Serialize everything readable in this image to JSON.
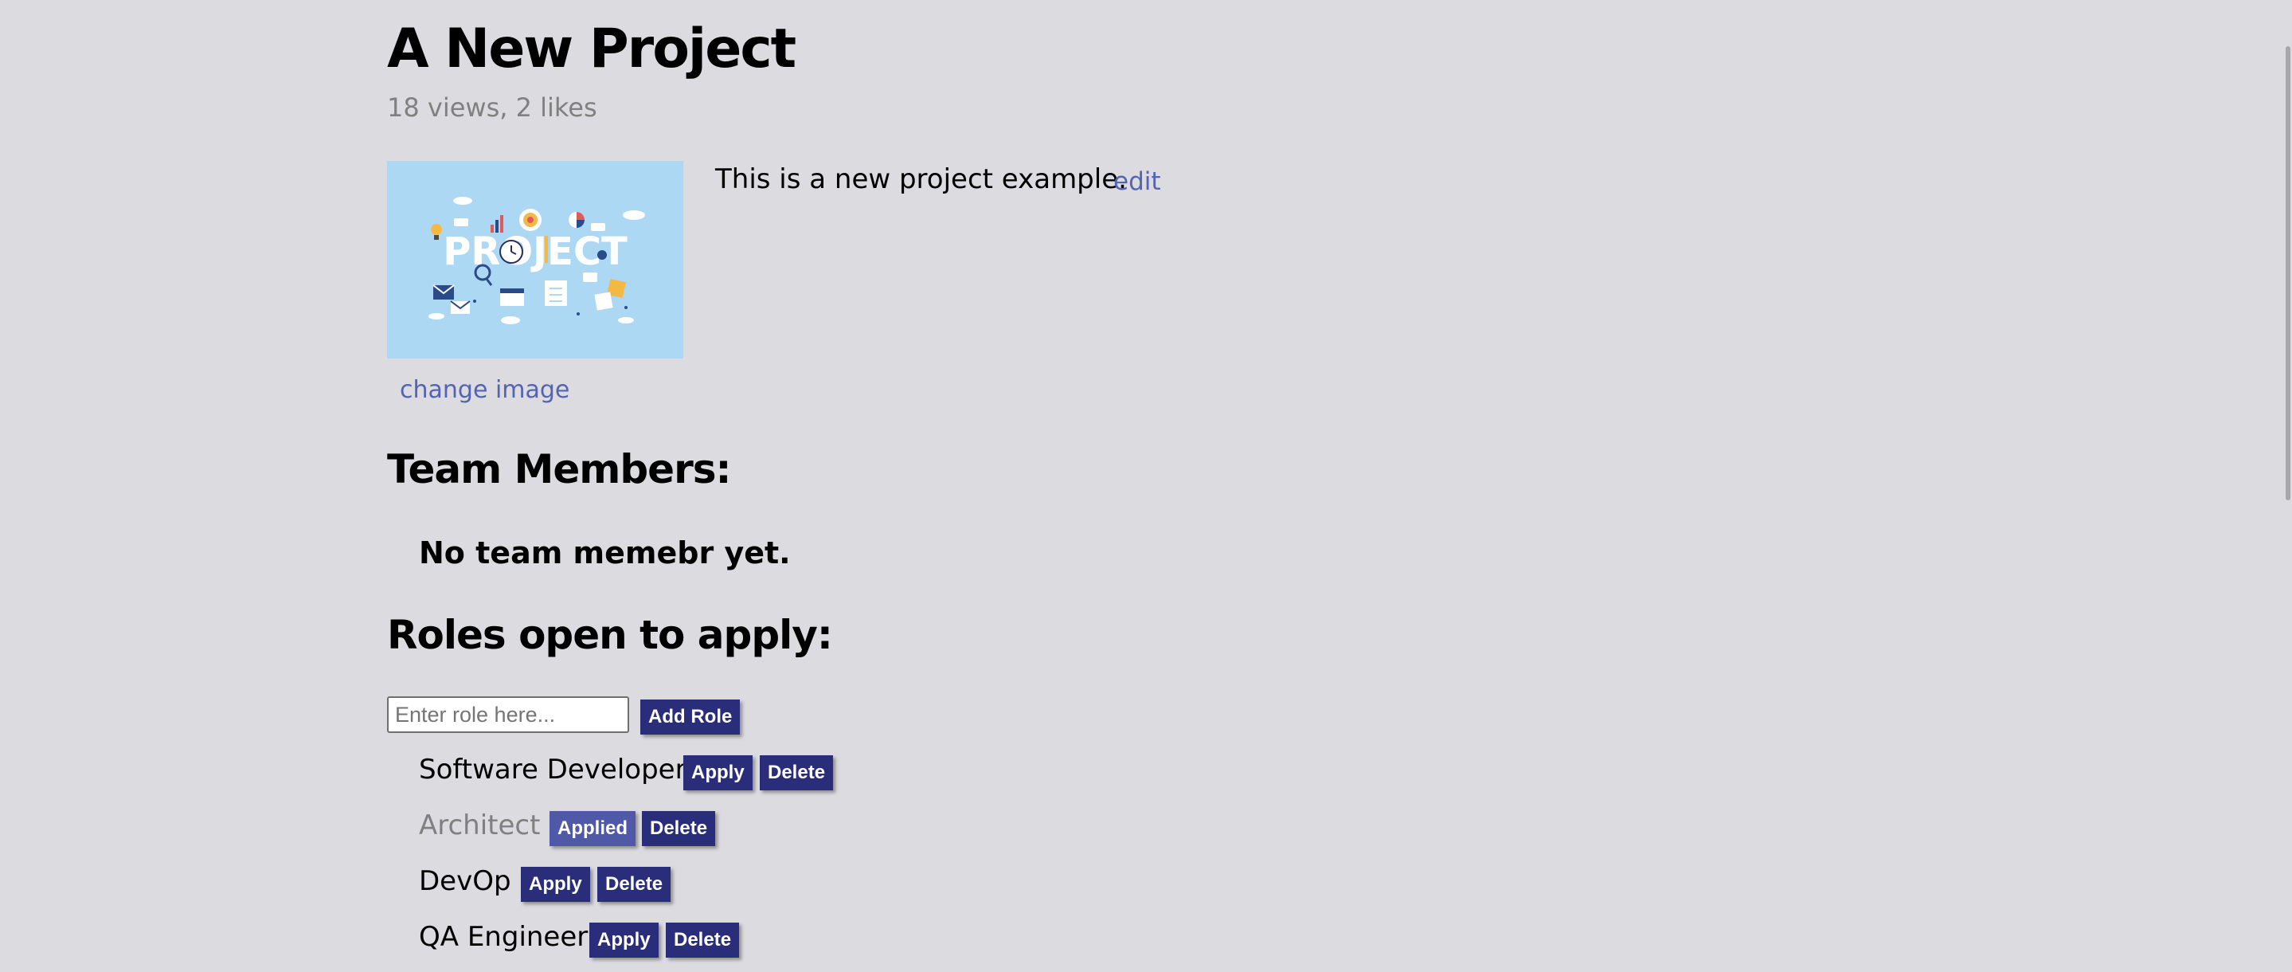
{
  "project": {
    "title": "A New Project",
    "stats": "18 views, 2 likes",
    "description": "This is a new project example.",
    "edit_label": "edit",
    "change_image_label": "change image",
    "image_text": "PROJECT"
  },
  "team": {
    "heading": "Team Members:",
    "empty_message": "No team memebr yet."
  },
  "roles": {
    "heading": "Roles open to apply:",
    "input_placeholder": "Enter role here...",
    "add_button_label": "Add Role",
    "items": [
      {
        "name": "Software Developer",
        "action_label": "Apply",
        "delete_label": "Delete",
        "applied": false
      },
      {
        "name": "Architect",
        "action_label": "Applied",
        "delete_label": "Delete",
        "applied": true
      },
      {
        "name": "DevOp",
        "action_label": "Apply",
        "delete_label": "Delete",
        "applied": false
      },
      {
        "name": "QA Engineer",
        "action_label": "Apply",
        "delete_label": "Delete",
        "applied": false
      }
    ]
  },
  "colors": {
    "background": "#dcdbdf",
    "link": "#5463b3",
    "button": "#2a2e7a",
    "button_applied": "#5058a8",
    "muted_text": "#808080",
    "image_background": "#add8f3"
  }
}
